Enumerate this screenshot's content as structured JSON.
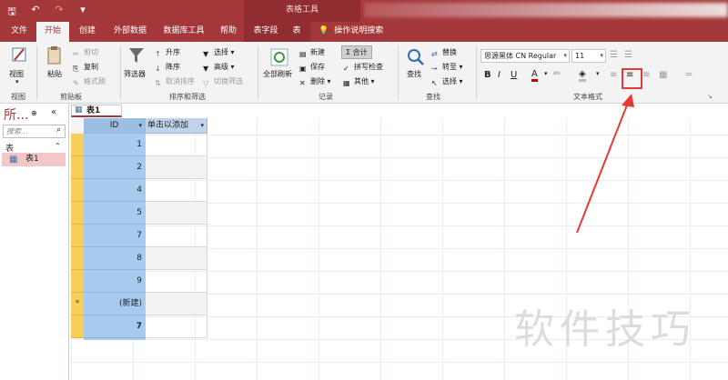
{
  "window": {
    "context_title": "表格工具"
  },
  "tabs": [
    "文件",
    "开始",
    "创建",
    "外部数据",
    "数据库工具",
    "帮助",
    "表字段",
    "表"
  ],
  "tell_me": "操作说明搜索",
  "groups": {
    "views": {
      "label": "视图",
      "view_button": "视图"
    },
    "clipboard": {
      "label": "剪贴板",
      "paste": "粘贴",
      "cut": "剪切",
      "copy": "复制",
      "format_painter": "格式刷"
    },
    "sort_filter": {
      "label": "排序和筛选",
      "filter": "筛选器",
      "ascending": "升序",
      "descending": "降序",
      "remove_sort": "取消排序",
      "selection": "选择",
      "advanced": "高级",
      "toggle_filter": "切换筛选"
    },
    "records": {
      "label": "记录",
      "refresh_all": "全部刷新",
      "new": "新建",
      "save": "保存",
      "delete": "删除",
      "totals": "合计",
      "spelling": "拼写检查",
      "more": "其他"
    },
    "find": {
      "label": "查找",
      "find": "查找",
      "replace": "替换",
      "goto": "转至",
      "select": "选择"
    },
    "text_format": {
      "label": "文本格式",
      "font": "思源黑体 CN Regular",
      "size": "11",
      "bold": "B",
      "italic": "I",
      "underline": "U",
      "font_color": "A"
    }
  },
  "nav": {
    "header": "所...",
    "search_placeholder": "搜索...",
    "section": "表",
    "items": [
      "表1"
    ]
  },
  "document_tab": "表1",
  "table": {
    "columns": [
      "ID",
      "单击以添加"
    ],
    "rows": [
      "1",
      "2",
      "4",
      "5",
      "7",
      "8",
      "9",
      "(新建)"
    ],
    "total": "7"
  },
  "watermark": "软件技巧",
  "colors": {
    "accent": "#a4373a",
    "highlight_box": "#e53935",
    "selected_column": "#a7cbee"
  }
}
